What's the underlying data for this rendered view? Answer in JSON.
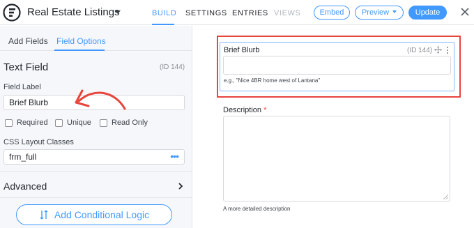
{
  "header": {
    "form_title": "Real Estate Listings",
    "nav": [
      "BUILD",
      "SETTINGS",
      "ENTRIES",
      "VIEWS"
    ],
    "active_nav": "BUILD",
    "embed_label": "Embed",
    "preview_label": "Preview",
    "update_label": "Update",
    "accent_color": "#4199fd"
  },
  "sidebar": {
    "tabs": [
      "Add Fields",
      "Field Options"
    ],
    "active_tab": "Field Options",
    "field_type": "Text Field",
    "field_id": "(ID 144)",
    "field_label_caption": "Field Label",
    "field_label_value": "Brief Blurb",
    "checkboxes": [
      "Required",
      "Unique",
      "Read Only"
    ],
    "css_caption": "CSS Layout Classes",
    "css_value": "frm_full",
    "css_more_icon": "•••",
    "advanced_label": "Advanced",
    "conditional_logic_label": "Add Conditional Logic"
  },
  "canvas": {
    "selected_field": {
      "label": "Brief Blurb",
      "id": "(ID 144)",
      "description": "e.g., \"Nice 4BR home west of Lantana\""
    },
    "description_field": {
      "label": "Description",
      "required_mark": "*",
      "description": "A more detailed description"
    },
    "highlight_color": "#e8453c"
  }
}
